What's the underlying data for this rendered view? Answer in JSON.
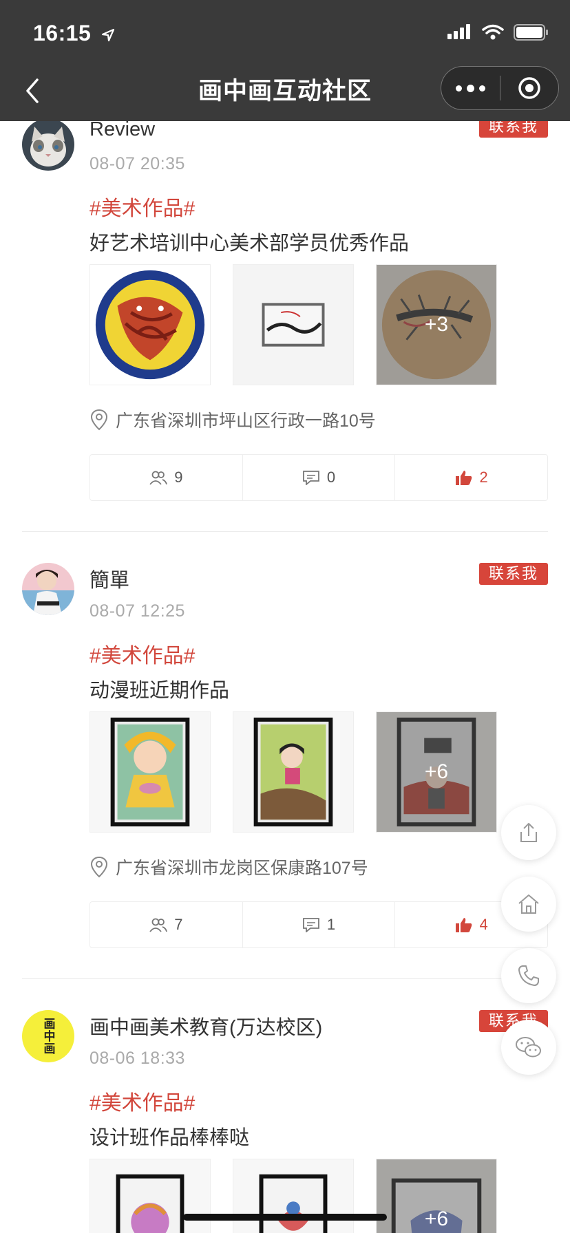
{
  "status_bar": {
    "time": "16:15"
  },
  "nav": {
    "title": "画中画互动社区"
  },
  "contact_label": "联系我",
  "posts": [
    {
      "name": "Review",
      "date": "08-07 20:35",
      "tag": "#美术作品#",
      "text": "好艺术培训中心美术部学员优秀作品",
      "more_images": "+3",
      "location": "广东省深圳市坪山区行政一路10号",
      "views": "9",
      "comments": "0",
      "likes": "2"
    },
    {
      "name": "簡單",
      "date": "08-07 12:25",
      "tag": "#美术作品#",
      "text": "动漫班近期作品",
      "more_images": "+6",
      "location": "广东省深圳市龙岗区保康路107号",
      "views": "7",
      "comments": "1",
      "likes": "4"
    },
    {
      "name": "画中画美术教育(万达校区)",
      "date": "08-06 18:33",
      "tag": "#美术作品#",
      "text": "设计班作品棒棒哒",
      "more_images": "+6",
      "avatar_text": "画中画"
    }
  ],
  "colors": {
    "accent": "#d2473c",
    "header": "#3a3a3a"
  }
}
